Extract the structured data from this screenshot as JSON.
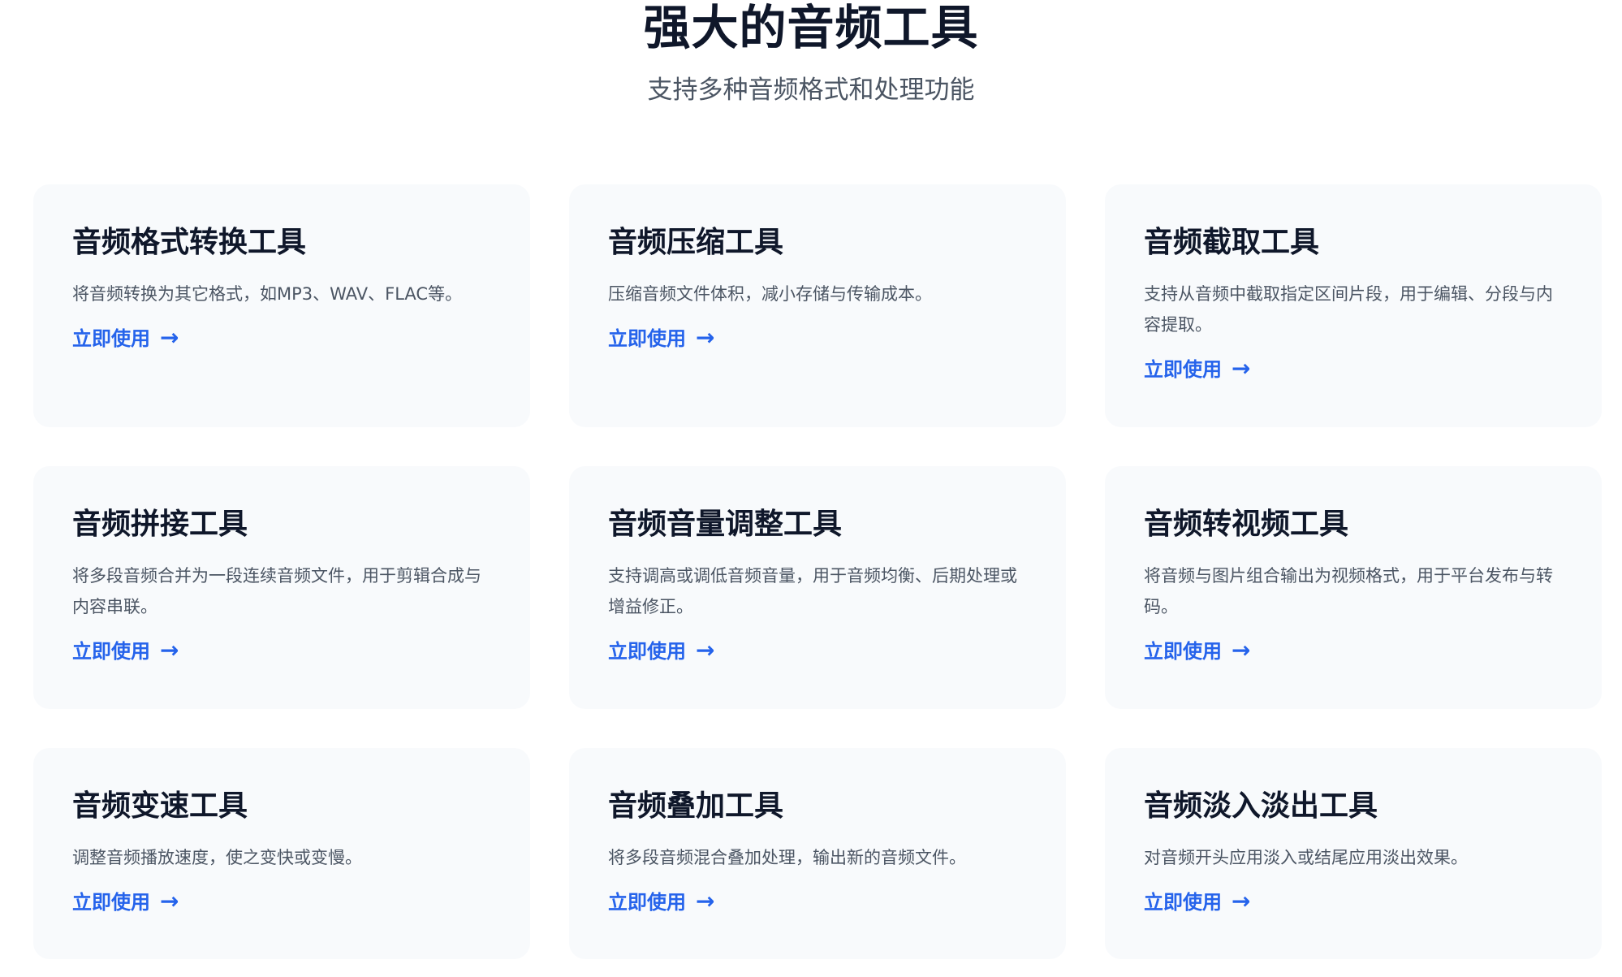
{
  "hero": {
    "title": "强大的音频工具",
    "subtitle": "支持多种音频格式和处理功能"
  },
  "cards": [
    {
      "title": "音频格式转换工具",
      "description": "将音频转换为其它格式，如MP3、WAV、FLAC等。",
      "link_label": "立即使用",
      "link_icon": "arrow-right-icon"
    },
    {
      "title": "音频压缩工具",
      "description": "压缩音频文件体积，减小存储与传输成本。",
      "link_label": "立即使用",
      "link_icon": "arrow-right-icon"
    },
    {
      "title": "音频截取工具",
      "description": "支持从音频中截取指定区间片段，用于编辑、分段与内容提取。",
      "link_label": "立即使用",
      "link_icon": "arrow-right-icon"
    },
    {
      "title": "音频拼接工具",
      "description": "将多段音频合并为一段连续音频文件，用于剪辑合成与内容串联。",
      "link_label": "立即使用",
      "link_icon": "arrow-right-icon"
    },
    {
      "title": "音频音量调整工具",
      "description": "支持调高或调低音频音量，用于音频均衡、后期处理或增益修正。",
      "link_label": "立即使用",
      "link_icon": "arrow-right-icon"
    },
    {
      "title": "音频转视频工具",
      "description": "将音频与图片组合输出为视频格式，用于平台发布与转码。",
      "link_label": "立即使用",
      "link_icon": "arrow-right-icon"
    },
    {
      "title": "音频变速工具",
      "description": "调整音频播放速度，使之变快或变慢。",
      "link_label": "立即使用",
      "link_icon": "arrow-right-icon"
    },
    {
      "title": "音频叠加工具",
      "description": "将多段音频混合叠加处理，输出新的音频文件。",
      "link_label": "立即使用",
      "link_icon": "arrow-right-icon"
    },
    {
      "title": "音频淡入淡出工具",
      "description": "对音频开头应用淡入或结尾应用淡出效果。",
      "link_label": "立即使用",
      "link_icon": "arrow-right-icon"
    }
  ],
  "colors": {
    "accent": "#2563eb",
    "card_background": "#f8fafc",
    "title": "#0f172a",
    "text": "#4b5563"
  }
}
